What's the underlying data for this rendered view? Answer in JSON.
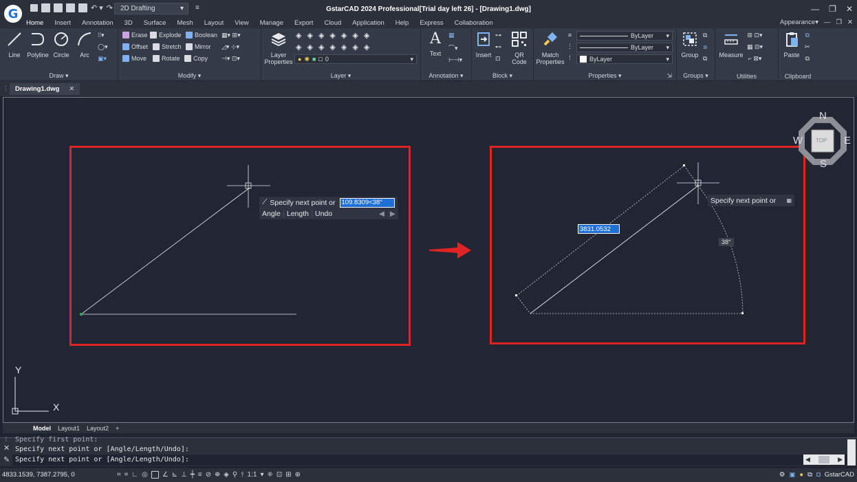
{
  "titlebar": {
    "workspace": "2D Drafting",
    "title": "GstarCAD 2024 Professional[Trial day left 26] - [Drawing1.dwg]",
    "window_controls": [
      "—",
      "❐",
      "✕"
    ]
  },
  "ribbon_tabs": [
    "Home",
    "Insert",
    "Annotation",
    "3D",
    "Surface",
    "Mesh",
    "Layout",
    "View",
    "Manage",
    "Export",
    "Cloud",
    "Application",
    "Help",
    "Express",
    "Collaboration"
  ],
  "ribbon_right": {
    "appearance": "Appearance"
  },
  "panels": {
    "draw": {
      "title": "Draw",
      "buttons": [
        "Line",
        "Polyline",
        "Circle",
        "Arc"
      ]
    },
    "modify": {
      "title": "Modify",
      "items": [
        "Erase",
        "Explode",
        "Boolean",
        "Offset",
        "Stretch",
        "Mirror",
        "Move",
        "Rotate",
        "Copy"
      ]
    },
    "layer": {
      "title": "Layer",
      "button": "Layer\nProperties",
      "layer_value": "0"
    },
    "annotation": {
      "title": "Annotation",
      "button": "Text"
    },
    "block": {
      "title": "Block",
      "buttons": [
        "Insert",
        "QR\nCode"
      ]
    },
    "properties": {
      "title": "Properties",
      "button": "Match\nProperties",
      "combos": [
        "ByLayer",
        "ByLayer",
        "ByLayer"
      ]
    },
    "groups": {
      "title": "Groups",
      "button": "Group"
    },
    "utilities": {
      "title": "Utilities",
      "button": "Measure"
    },
    "clipboard": {
      "title": "Clipboard",
      "button": "Paste"
    }
  },
  "document_tab": {
    "name": "Drawing1.dwg"
  },
  "left_demo": {
    "prompt": "Specify next point or",
    "input_value": "109.8309<38°",
    "options": [
      "Angle",
      "Length",
      "Undo"
    ]
  },
  "right_demo": {
    "prompt": "Specify next point or",
    "length_value": "3831.0532",
    "angle_label": "38°"
  },
  "viewcube": {
    "n": "N",
    "s": "S",
    "e": "E",
    "w": "W",
    "face": "TOP"
  },
  "ucs": {
    "x": "X",
    "y": "Y"
  },
  "layout_tabs": [
    "Model",
    "Layout1",
    "Layout2",
    "+"
  ],
  "command": {
    "history": "Specify first point:",
    "line1": "Specify next point or [Angle/Length/Undo]:",
    "line2": "Specify next point or [Angle/Length/Undo]:"
  },
  "status": {
    "coords": "4833.1539, 7387.2795, 0",
    "scale": "1:1",
    "brand": "GstarCAD"
  },
  "colors": {
    "accent": "#1f6fd6",
    "frame": "#e02424",
    "canvas": "#212632"
  }
}
